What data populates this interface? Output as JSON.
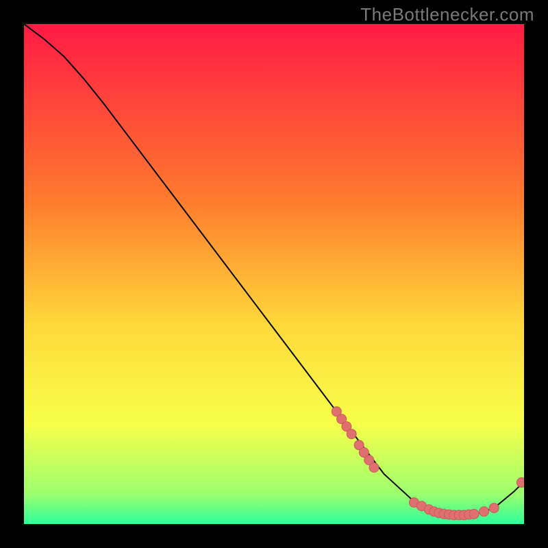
{
  "watermark": "TheBottlenecker.com",
  "colors": {
    "bg": "#000000",
    "watermark": "#7a7a7a",
    "line": "#000000",
    "dot_fill": "#e07070",
    "dot_stroke": "#c85a5a",
    "grad_top": "#ff1a44",
    "grad_mid1": "#ff7a2e",
    "grad_mid2": "#ffd83a",
    "grad_mid3": "#f7ff4a",
    "grad_bot1": "#9cff6e",
    "grad_bot2": "#2eff9c"
  },
  "chart_data": {
    "type": "line",
    "title": "",
    "xlabel": "",
    "ylabel": "",
    "xlim": [
      0,
      100
    ],
    "ylim": [
      0,
      100
    ],
    "grid": false,
    "legend": false,
    "line_xy": [
      [
        0,
        100
      ],
      [
        4,
        97
      ],
      [
        8,
        93.5
      ],
      [
        12,
        89
      ],
      [
        16,
        84
      ],
      [
        62.5,
        22.5
      ],
      [
        72,
        10
      ],
      [
        78,
        4.5
      ],
      [
        82,
        2.4
      ],
      [
        85,
        1.8
      ],
      [
        90,
        1.8
      ],
      [
        94,
        3.2
      ],
      [
        98,
        6.5
      ],
      [
        100,
        8.5
      ]
    ],
    "dot_clusters": [
      {
        "approx_x_range": [
          62,
          70
        ],
        "approx_y_range": [
          10,
          23
        ],
        "count": 8
      },
      {
        "approx_x_range": [
          78,
          94
        ],
        "approx_y_range": [
          1.5,
          4.5
        ],
        "count": 14
      },
      {
        "approx_x_range": [
          99,
          100
        ],
        "approx_y_range": [
          8,
          9
        ],
        "count": 1
      }
    ],
    "dots_xy": [
      [
        62.5,
        22.5
      ],
      [
        63.5,
        21.0
      ],
      [
        64.5,
        19.5
      ],
      [
        65.5,
        18.0
      ],
      [
        67.0,
        15.8
      ],
      [
        68.0,
        14.3
      ],
      [
        69.0,
        12.8
      ],
      [
        70.0,
        11.3
      ],
      [
        78.0,
        4.3
      ],
      [
        79.5,
        3.6
      ],
      [
        81.0,
        2.9
      ],
      [
        82.0,
        2.5
      ],
      [
        83.0,
        2.2
      ],
      [
        84.0,
        2.0
      ],
      [
        85.0,
        1.9
      ],
      [
        86.0,
        1.8
      ],
      [
        87.0,
        1.8
      ],
      [
        88.0,
        1.8
      ],
      [
        89.0,
        1.9
      ],
      [
        90.0,
        2.0
      ],
      [
        92.0,
        2.5
      ],
      [
        94.0,
        3.2
      ],
      [
        99.5,
        8.3
      ]
    ]
  }
}
